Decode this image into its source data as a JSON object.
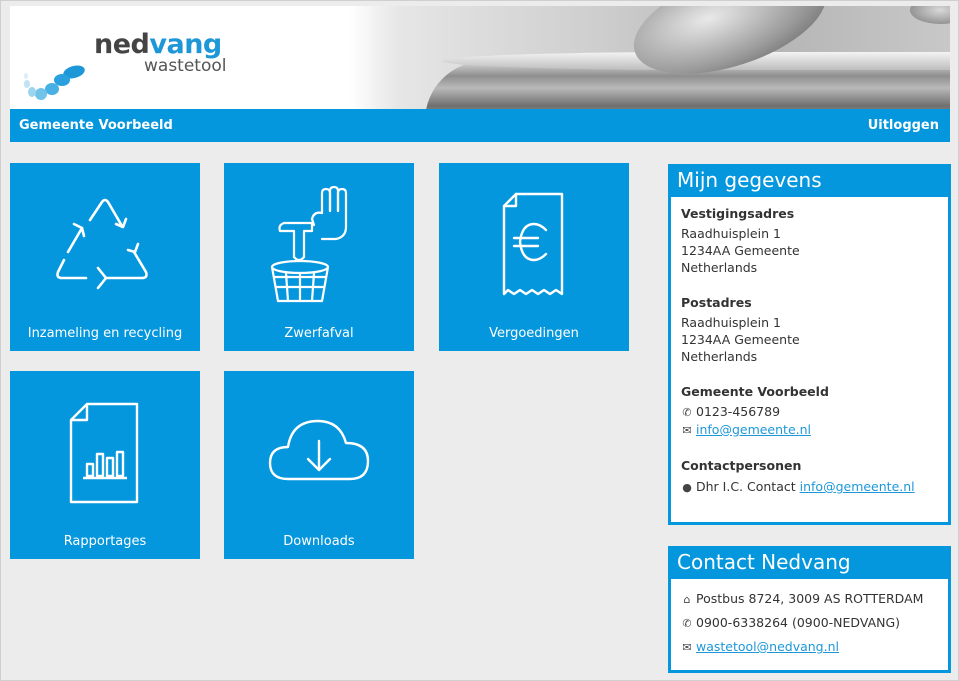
{
  "brand": {
    "name_part1": "ned",
    "name_part2": "vang",
    "product": "wastetool",
    "accent": "#0597de"
  },
  "topbar": {
    "organization": "Gemeente Voorbeeld",
    "logout_label": "Uitloggen"
  },
  "tiles": [
    {
      "label": "Inzameling en recycling",
      "icon": "recycle-icon"
    },
    {
      "label": "Zwerfafval",
      "icon": "litter-bin-icon"
    },
    {
      "label": "Vergoedingen",
      "icon": "euro-receipt-icon"
    },
    {
      "label": "Rapportages",
      "icon": "report-chart-icon"
    },
    {
      "label": "Downloads",
      "icon": "cloud-download-icon"
    }
  ],
  "mijn_gegevens": {
    "title": "Mijn gegevens",
    "vestigingsadres": {
      "heading": "Vestigingsadres",
      "line1": "Raadhuisplein 1",
      "line2": "1234AA Gemeente",
      "line3": "Netherlands"
    },
    "postadres": {
      "heading": "Postadres",
      "line1": "Raadhuisplein 1",
      "line2": "1234AA Gemeente",
      "line3": "Netherlands"
    },
    "gemeente": {
      "heading": "Gemeente Voorbeeld",
      "phone": "0123-456789",
      "email": "info@gemeente.nl"
    },
    "contactpersonen": {
      "heading": "Contactpersonen",
      "person": "Dhr I.C. Contact",
      "email": "info@gemeente.nl"
    }
  },
  "contact_nedvang": {
    "title": "Contact Nedvang",
    "address": "Postbus 8724, 3009 AS ROTTERDAM",
    "phone": "0900-6338264 (0900-NEDVANG)",
    "email": "wastetool@nedvang.nl"
  }
}
